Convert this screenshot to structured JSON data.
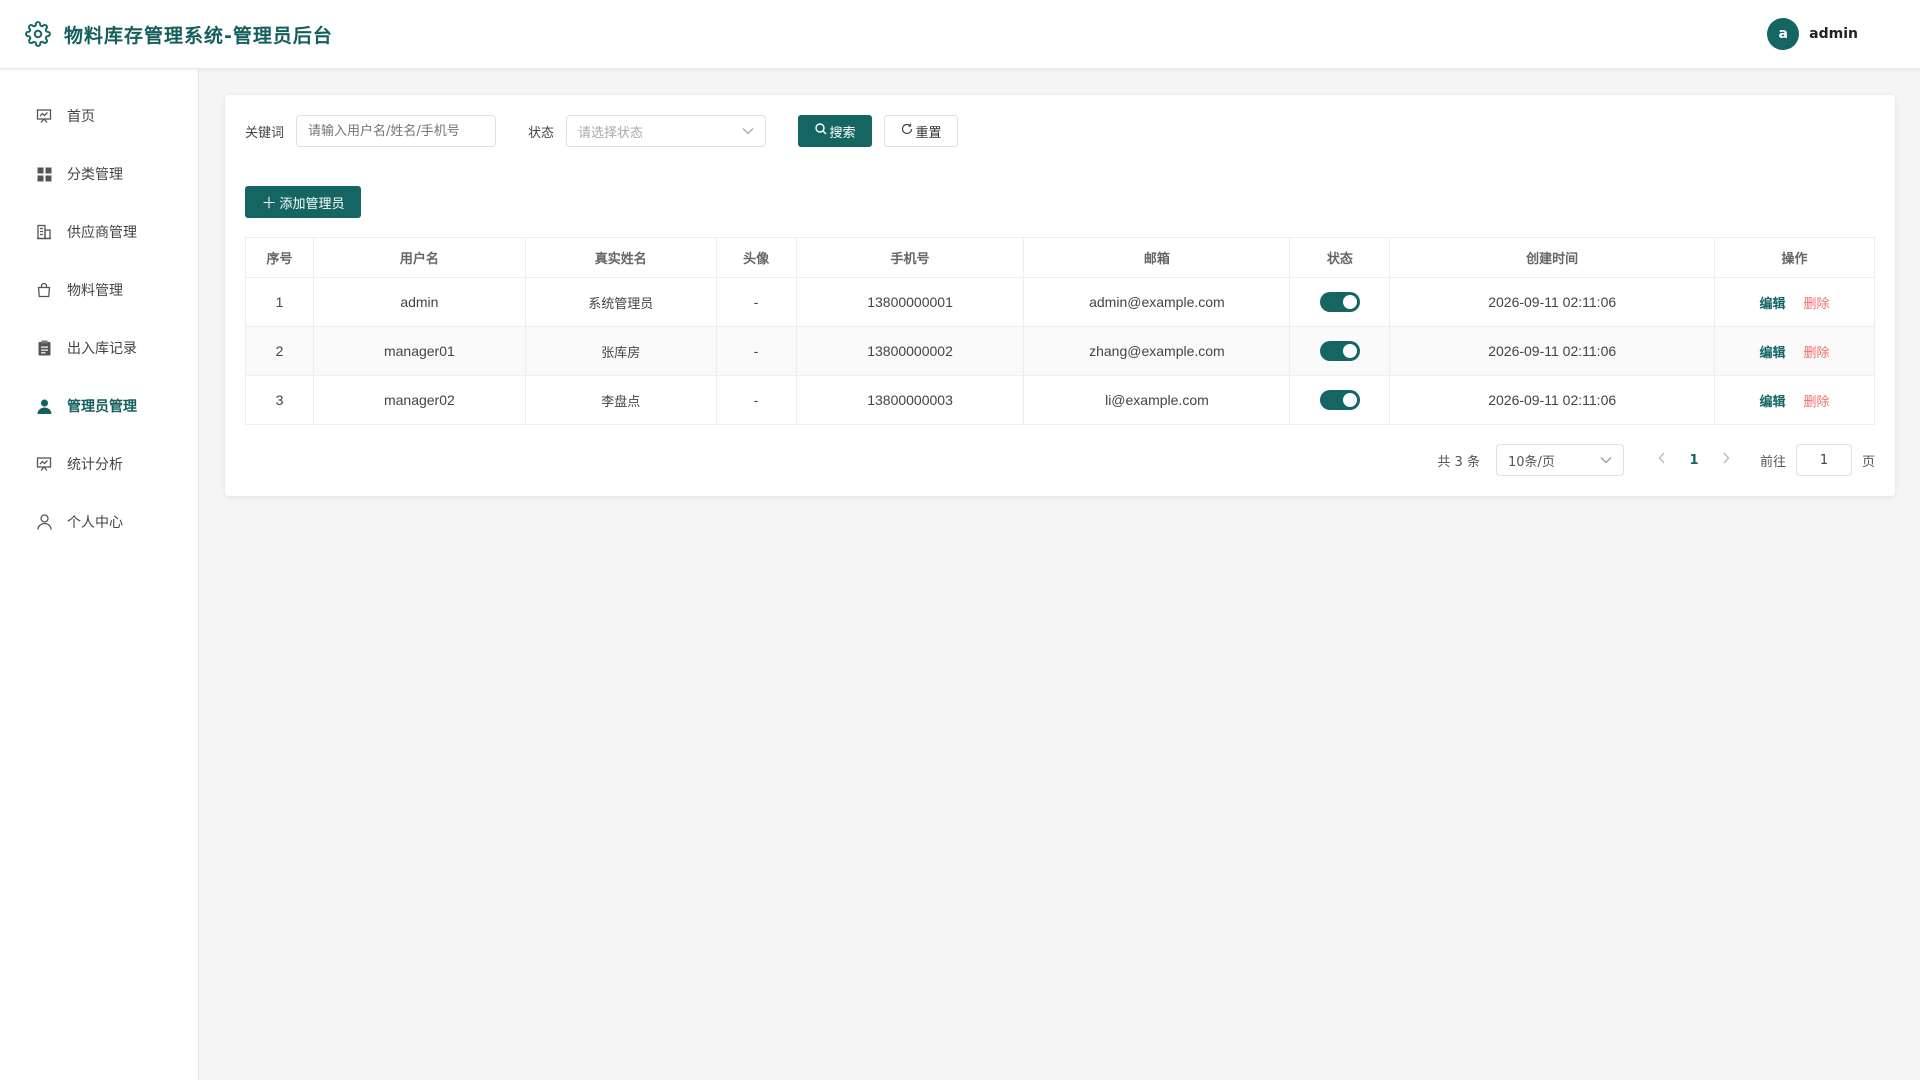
{
  "header": {
    "title": "物料库存管理系统-管理员后台",
    "user_initial": "a",
    "username": "admin"
  },
  "sidebar": {
    "items": [
      {
        "label": "首页",
        "icon": "dashboard-icon",
        "active": false
      },
      {
        "label": "分类管理",
        "icon": "grid-icon",
        "active": false
      },
      {
        "label": "供应商管理",
        "icon": "building-icon",
        "active": false
      },
      {
        "label": "物料管理",
        "icon": "bag-icon",
        "active": false
      },
      {
        "label": "出入库记录",
        "icon": "clipboard-icon",
        "active": false
      },
      {
        "label": "管理员管理",
        "icon": "user-filled-icon",
        "active": true
      },
      {
        "label": "统计分析",
        "icon": "chart-icon",
        "active": false
      },
      {
        "label": "个人中心",
        "icon": "user-icon",
        "active": false
      }
    ]
  },
  "filters": {
    "keyword_label": "关键词",
    "keyword_placeholder": "请输入用户名/姓名/手机号",
    "status_label": "状态",
    "status_placeholder": "请选择状态",
    "search_label": "搜索",
    "reset_label": "重置"
  },
  "actions": {
    "add_label": "添加管理员"
  },
  "table": {
    "columns": [
      "序号",
      "用户名",
      "真实姓名",
      "头像",
      "手机号",
      "邮箱",
      "状态",
      "创建时间",
      "操作"
    ],
    "rows": [
      {
        "index": "1",
        "username": "admin",
        "real_name": "系统管理员",
        "avatar": "-",
        "phone": "13800000001",
        "email": "admin@example.com",
        "enabled": true,
        "created": "2026-09-11 02:11:06",
        "edit": "编辑",
        "delete": "删除"
      },
      {
        "index": "2",
        "username": "manager01",
        "real_name": "张库房",
        "avatar": "-",
        "phone": "13800000002",
        "email": "zhang@example.com",
        "enabled": true,
        "created": "2026-09-11 02:11:06",
        "edit": "编辑",
        "delete": "删除"
      },
      {
        "index": "3",
        "username": "manager02",
        "real_name": "李盘点",
        "avatar": "-",
        "phone": "13800000003",
        "email": "li@example.com",
        "enabled": true,
        "created": "2026-09-11 02:11:06",
        "edit": "编辑",
        "delete": "删除"
      }
    ]
  },
  "pagination": {
    "total": "共 3 条",
    "page_size": "10条/页",
    "current": "1",
    "goto_label": "前往",
    "goto_value": "1",
    "page_suffix": "页"
  },
  "colors": {
    "primary": "#156663",
    "danger": "#f56c6c"
  }
}
